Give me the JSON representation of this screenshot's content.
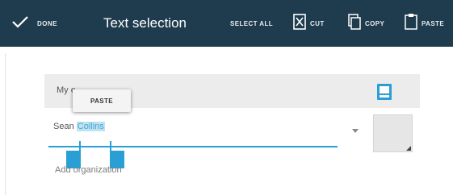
{
  "actionbar": {
    "done_label": "DONE",
    "title": "Text selection",
    "select_all_label": "SELECT ALL",
    "cut_label": "CUT",
    "copy_label": "COPY",
    "paste_label": "PASTE"
  },
  "form": {
    "row_text": "My                    e",
    "name_prefix": "Sean ",
    "name_selected": "Collins",
    "add_org_label": "Add organization"
  },
  "popup": {
    "paste_label": "PASTE"
  },
  "colors": {
    "actionbar_bg": "#1f3c4e",
    "accent": "#2a9fd6",
    "selection_bg": "#bde3f3"
  },
  "icons": {
    "done": "check-icon",
    "cut": "cut-icon",
    "copy": "copy-icon",
    "paste": "clipboard-icon",
    "row": "contact-card-icon"
  }
}
